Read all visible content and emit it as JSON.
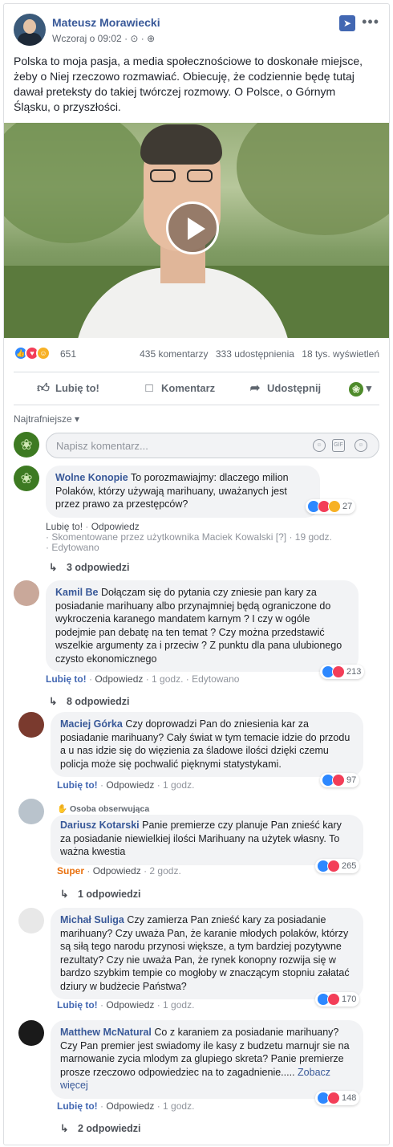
{
  "post": {
    "author": "Mateusz Morawiecki",
    "time": "Wczoraj o 09:02",
    "meta_icons": "· ⊙ · ⊕",
    "text": "Polska to moja pasja, a media społecznościowe to doskonałe miejsce, żeby o Niej rzeczowo rozmawiać. Obiecuję, że codziennie będę tutaj dawał preteksty do takiej twórczej rozmowy. O Polsce, o Górnym Śląsku, o przyszłości.",
    "reactions_count": "651",
    "comments": "435 komentarzy",
    "shares": "333 udostępnienia",
    "views": "18 tys. wyświetleń",
    "actions": {
      "like": "Lubię to!",
      "comment": "Komentarz",
      "share": "Udostępnij"
    },
    "sort_label": "Najtrafniejsze ▾",
    "compose_placeholder": "Napisz komentarz..."
  },
  "comments": [
    {
      "author": "Wolne Konopie",
      "text": "To porozmawiajmy: dlaczego milion Polaków, którzy używają marihuany, uważanych jest przez prawo za przestępców?",
      "reactions": "27",
      "link1": "Lubię to!",
      "link2": "Odpowiedz",
      "line2": "· Skomentowane przez użytkownika Maciek Kowalski [?] · 19 godz.",
      "line3": "· Edytowano",
      "replies": "3 odpowiedzi"
    },
    {
      "author": "Kamil Be",
      "text": "Dołączam się do pytania czy zniesie pan kary za posiadanie marihuany albo przynajmniej będą ograniczone do wykroczenia karanego mandatem karnym ? I czy w ogóle podejmie pan debatę na ten temat ? Czy można przedstawić wszelkie argumenty za i przeciw ? Z punktu dla pana ulubionego czysto ekonomicznego",
      "reactions": "213",
      "link1": "Lubię to!",
      "link2": "Odpowiedz",
      "time": "· 1 godz. · Edytowano",
      "replies": "8 odpowiedzi"
    },
    {
      "author": "Maciej Górka",
      "text": "Czy doprowadzi Pan do zniesienia kar za posiadanie marihuany? Cały świat w tym temacie idzie do przodu a u nas idzie się do więzienia za śladowe ilości dzięki czemu policja może się pochwalić pięknymi statystykami.",
      "reactions": "97",
      "link1": "Lubię to!",
      "link2": "Odpowiedz",
      "time": "· 1 godz."
    },
    {
      "follow_label": "Osoba obserwująca",
      "author": "Dariusz Kotarski",
      "text": "Panie premierze czy planuje Pan znieść kary za posiadanie niewielkiej ilości Marihuany na użytek własny. To ważna kwestia",
      "reactions": "265",
      "link1": "Super",
      "link2": "Odpowiedz",
      "time": "· 2 godz.",
      "replies": "1 odpowiedzi"
    },
    {
      "author": "Michał Suliga",
      "text": "Czy zamierza Pan znieść kary za posiadanie marihuany? Czy uważa Pan, że karanie młodych polaków, którzy są siłą tego narodu przynosi większe, a tym bardziej pozytywne rezultaty? Czy nie uważa Pan, że rynek konopny rozwija się w bardzo szybkim tempie co mogłoby w znaczącym stopniu załatać dziury w budżecie Państwa?",
      "reactions": "170",
      "link1": "Lubię to!",
      "link2": "Odpowiedz",
      "time": "· 1 godz."
    },
    {
      "author": "Matthew McNatural",
      "text": "Co z karaniem za posiadanie marihuany? Czy Pan premier jest swiadomy ile kasy z budzetu marnujr sie na marnowanie zycia mlodym za glupiego skreta? Panie premierze prosze rzeczowo odpowiedziec na to zagadnienie.....",
      "see_more": "Zobacz więcej",
      "reactions": "148",
      "link1": "Lubię to!",
      "link2": "Odpowiedz",
      "time": "· 1 godz.",
      "replies": "2 odpowiedzi"
    }
  ]
}
